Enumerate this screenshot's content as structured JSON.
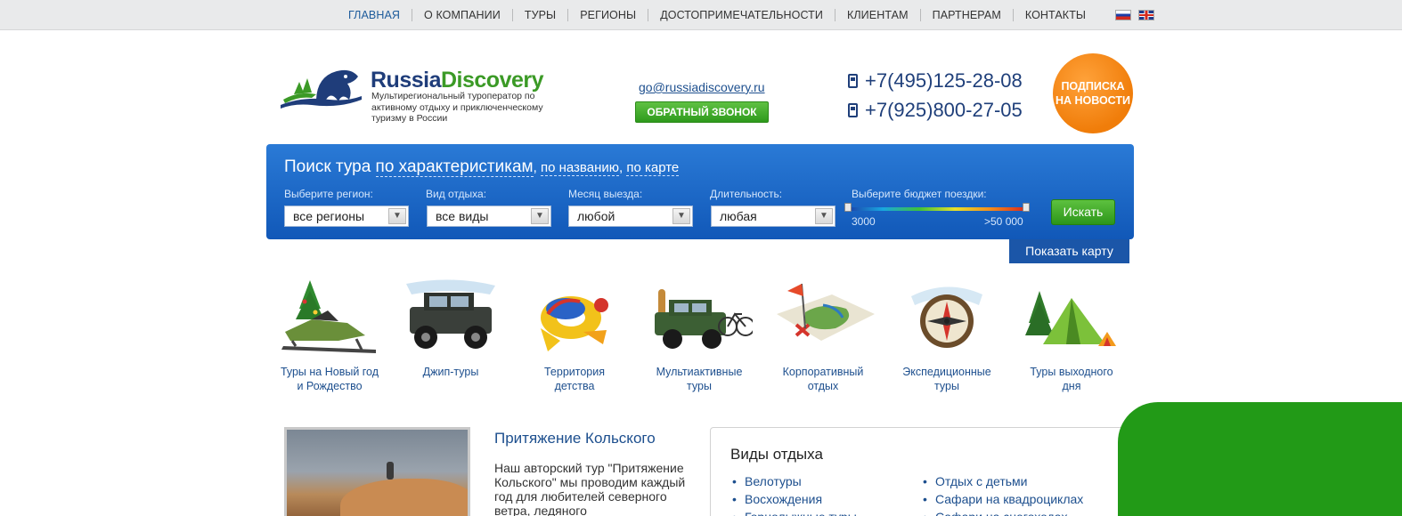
{
  "nav": {
    "items": [
      "ГЛАВНАЯ",
      "О КОМПАНИИ",
      "ТУРЫ",
      "РЕГИОНЫ",
      "ДОСТОПРИМЕЧАТЕЛЬНОСТИ",
      "КЛИЕНТАМ",
      "ПАРТНЕРАМ",
      "КОНТАКТЫ"
    ],
    "active": "ГЛАВНАЯ"
  },
  "header": {
    "brand_part1": "Russia",
    "brand_part2": "Discovery",
    "tagline": "Мультирегиональный туроператор по активному отдыху и приключенческому туризму в России",
    "email": "go@russiadiscovery.ru",
    "callback_label": "ОБРАТНЫЙ ЗВОНОК",
    "phone1": "+7(495)125-28-08",
    "phone2": "+7(925)800-27-05",
    "subscribe_line1": "ПОДПИСКА",
    "subscribe_line2": "НА НОВОСТИ"
  },
  "search": {
    "title_prefix": "Поиск тура",
    "by_features": "по характеристикам",
    "by_name": "по названию",
    "by_map": "по карте",
    "fields": [
      {
        "label": "Выберите регион:",
        "value": "все регионы"
      },
      {
        "label": "Вид отдыха:",
        "value": "все виды"
      },
      {
        "label": "Месяц выезда:",
        "value": "любой"
      },
      {
        "label": "Длительность:",
        "value": "любая"
      }
    ],
    "budget_label": "Выберите бюджет поездки:",
    "budget_min": "3000",
    "budget_max": ">50 000",
    "submit_label": "Искать",
    "show_map_label": "Показать карту"
  },
  "categories": [
    {
      "line1": "Туры на Новый год",
      "line2": "и Рождество",
      "icon": "snowmobile-icon"
    },
    {
      "line1": "Джип-туры",
      "line2": "",
      "icon": "jeep-icon"
    },
    {
      "line1": "Территория",
      "line2": "детства",
      "icon": "kids-toys-icon"
    },
    {
      "line1": "Мультиактивные",
      "line2": "туры",
      "icon": "jeep-bike-icon"
    },
    {
      "line1": "Корпоративный",
      "line2": "отдых",
      "icon": "map-flag-icon"
    },
    {
      "line1": "Экспедиционные",
      "line2": "туры",
      "icon": "compass-icon"
    },
    {
      "line1": "Туры выходного",
      "line2": "дня",
      "icon": "tent-icon"
    }
  ],
  "article": {
    "title": "Притяжение Кольского",
    "text": "Наш авторский тур \"Притяжение Кольского\" мы проводим каждый год для любителей северного ветра, ледяного"
  },
  "types": {
    "title": "Виды отдыха",
    "col1": [
      "Велотуры",
      "Восхождения",
      "Горнолыжные туры"
    ],
    "col2": [
      "Отдых с детьми",
      "Сафари на квадроциклах",
      "Сафари на снегоходах"
    ]
  },
  "colors": {
    "brand_blue": "#1f3d7a",
    "brand_green": "#3b9a26",
    "link": "#1d4f8e",
    "search_panel": "#1a66c6",
    "subscribe": "#f07d0a"
  }
}
